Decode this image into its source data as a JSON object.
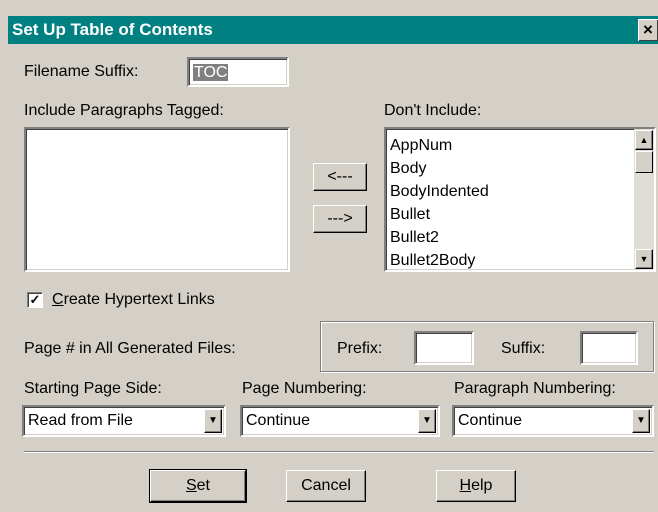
{
  "window": {
    "title": "Set Up Table of Contents",
    "close_glyph": "×"
  },
  "filename_suffix": {
    "label": "Filename Suffix:",
    "value": "TOC"
  },
  "include": {
    "label": "Include Paragraphs Tagged:",
    "items": []
  },
  "exclude": {
    "label": "Don't Include:",
    "items": [
      "AppNum",
      "Body",
      "BodyIndented",
      "Bullet",
      "Bullet2",
      "Bullet2Body"
    ]
  },
  "move_buttons": {
    "add": "<---",
    "remove": "--->"
  },
  "hypertext": {
    "label_underlined": "C",
    "label_rest": "reate Hypertext Links",
    "checked": true,
    "check_glyph": "✓"
  },
  "page_number": {
    "label": "Page # in All Generated Files:",
    "prefix_label": "Prefix:",
    "prefix_value": "",
    "suffix_label": "Suffix:",
    "suffix_value": ""
  },
  "starting_page_side": {
    "label": "Starting Page Side:",
    "value": "Read from File"
  },
  "page_numbering": {
    "label": "Page Numbering:",
    "value": "Continue"
  },
  "paragraph_numbering": {
    "label": "Paragraph Numbering:",
    "value": "Continue"
  },
  "buttons": {
    "set_underlined": "S",
    "set_rest": "et",
    "cancel": "Cancel",
    "help_underlined": "H",
    "help_rest": "elp"
  },
  "icons": {
    "scroll_up": "▲",
    "scroll_down": "▼",
    "dropdown": "▼"
  }
}
